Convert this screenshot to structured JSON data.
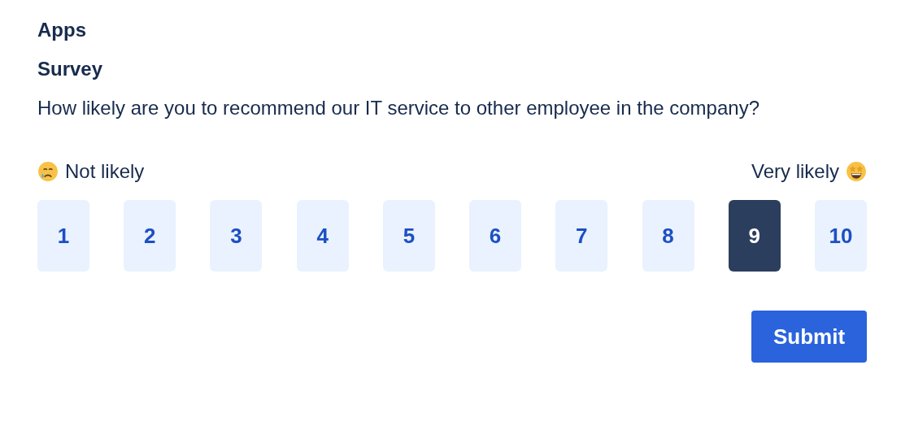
{
  "app_title": "Apps",
  "survey": {
    "title": "Survey",
    "question": "How likely are you to recommend our IT service to other employee in the company?",
    "low_label": "Not likely",
    "high_label": "Very likely",
    "options": [
      {
        "label": "1",
        "selected": false
      },
      {
        "label": "2",
        "selected": false
      },
      {
        "label": "3",
        "selected": false
      },
      {
        "label": "4",
        "selected": false
      },
      {
        "label": "5",
        "selected": false
      },
      {
        "label": "6",
        "selected": false
      },
      {
        "label": "7",
        "selected": false
      },
      {
        "label": "8",
        "selected": false
      },
      {
        "label": "9",
        "selected": true
      },
      {
        "label": "10",
        "selected": false
      }
    ],
    "submit": "Submit"
  }
}
